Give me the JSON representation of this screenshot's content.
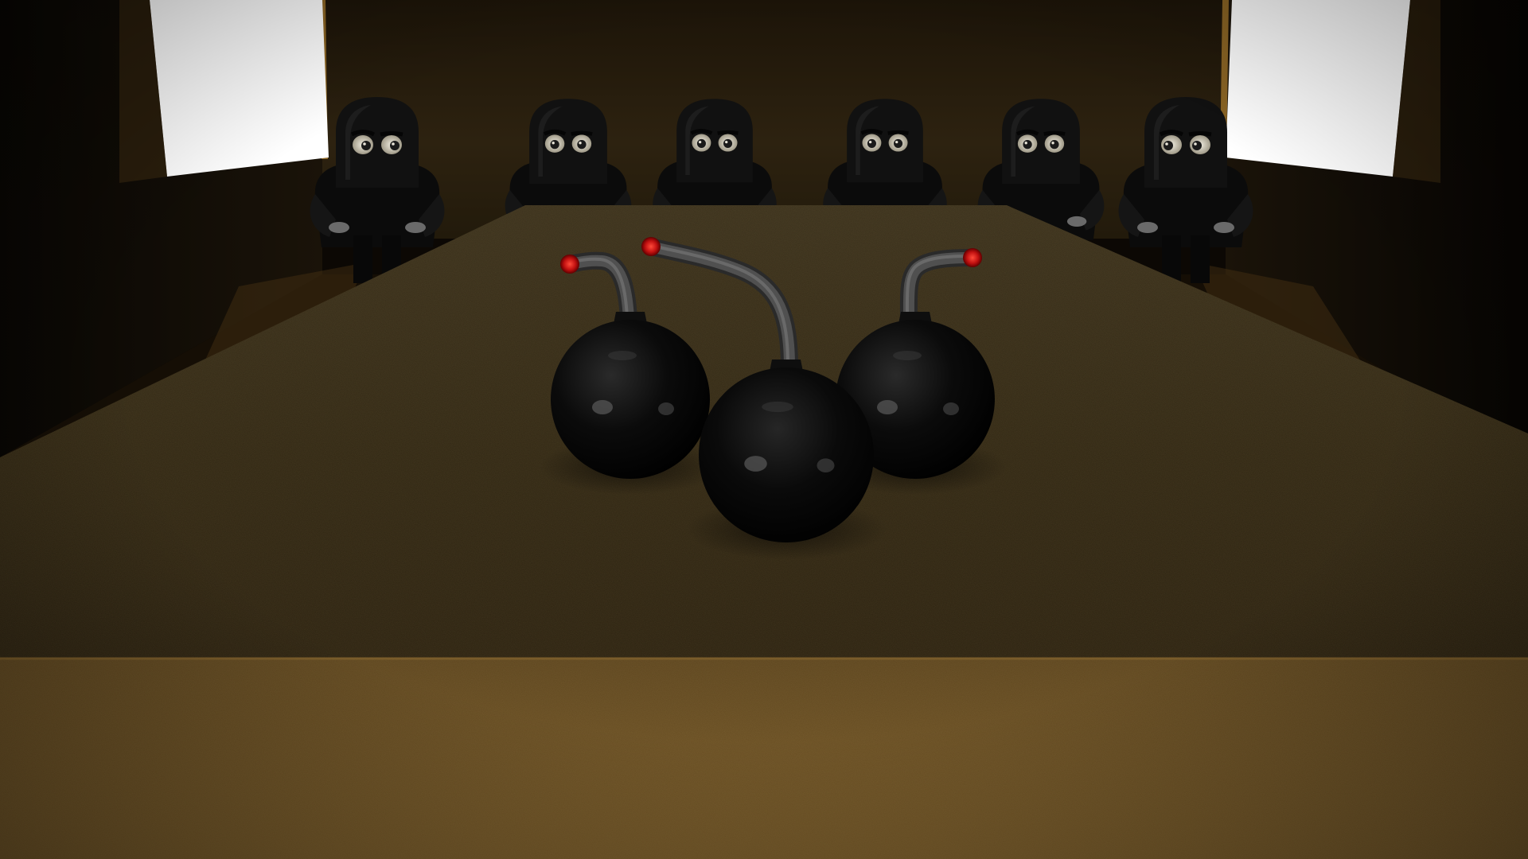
{
  "scene": {
    "type": "3d-render",
    "palette": {
      "back_wall": "#2a1f0c",
      "side_wall": "#120d05",
      "wall_edge": "#8a6424",
      "window": "#ffffff",
      "table_top": "#3a2f1a",
      "table_front": "#6e5326",
      "floor": "#1a1207",
      "figure_body": "#111111",
      "eye_white": "#d8d4c4",
      "bomb_body": "#070707",
      "fuse": "#505050",
      "spark": "#c01010"
    },
    "figures": [
      {
        "icon": "hooded-figure",
        "eye_glance": "right"
      },
      {
        "icon": "hooded-figure",
        "eye_glance": "center"
      },
      {
        "icon": "hooded-figure",
        "eye_glance": "center"
      },
      {
        "icon": "hooded-figure",
        "eye_glance": "center"
      },
      {
        "icon": "hooded-figure",
        "eye_glance": "center"
      },
      {
        "icon": "hooded-figure",
        "eye_glance": "left"
      }
    ],
    "bombs": [
      {
        "icon": "bomb-icon",
        "position": "left"
      },
      {
        "icon": "bomb-icon",
        "position": "center"
      },
      {
        "icon": "bomb-icon",
        "position": "right"
      }
    ]
  }
}
